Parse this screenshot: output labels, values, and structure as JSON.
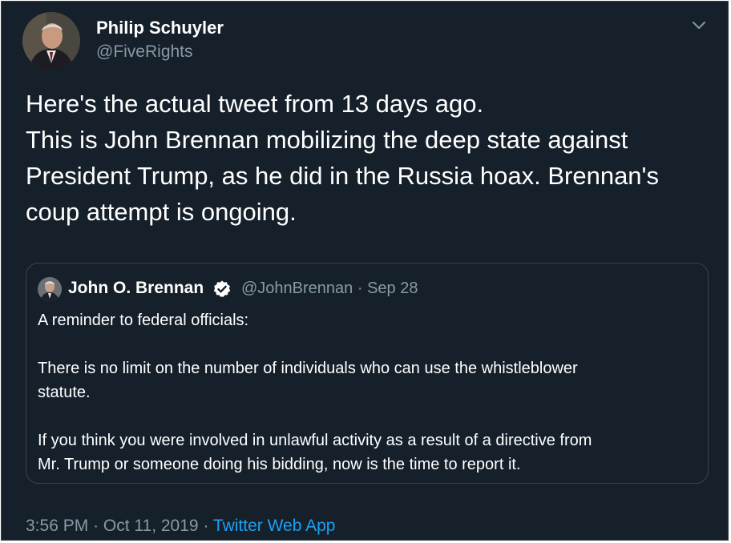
{
  "author": {
    "display_name": "Philip Schuyler",
    "handle": "@FiveRights",
    "avatar_icon": "portrait-avatar"
  },
  "menu_icon": "chevron-down-icon",
  "tweet_text_lines": [
    "Here's the actual tweet from 13 days ago.",
    "This is John Brennan mobilizing the deep state against",
    "President Trump, as he did in the Russia hoax. Brennan's",
    "coup attempt is ongoing."
  ],
  "quoted_tweet": {
    "display_name": "John O. Brennan",
    "verified_icon": "verified-badge-icon",
    "handle": "@JohnBrennan",
    "separator": "·",
    "date": "Sep 28",
    "paragraph_1": "A reminder to federal officials:",
    "paragraph_2_lines": [
      "There is no limit on the number of individuals who can use the whistleblower",
      "statute."
    ],
    "paragraph_3_lines": [
      "If you think you were involved in unlawful activity as a result of a directive from",
      "Mr. Trump or someone doing his bidding, now is the time to report it."
    ]
  },
  "footer": {
    "time": "3:56 PM",
    "separator": "·",
    "date": "Oct 11, 2019",
    "source": "Twitter Web App"
  },
  "colors": {
    "background": "#15202b",
    "border": "#38444d",
    "secondary_text": "#8899a6",
    "link": "#1da1f2"
  }
}
